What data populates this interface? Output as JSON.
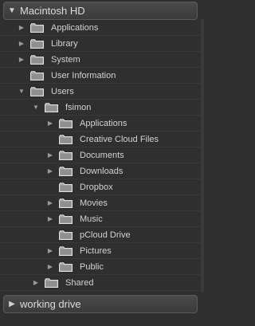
{
  "volume_header": {
    "arrow": "▼",
    "title": "Macintosh HD",
    "expanded": true
  },
  "tree": [
    {
      "label": "Applications",
      "depth": 0,
      "expander": "collapsed"
    },
    {
      "label": "Library",
      "depth": 0,
      "expander": "collapsed"
    },
    {
      "label": "System",
      "depth": 0,
      "expander": "collapsed"
    },
    {
      "label": "User Information",
      "depth": 0,
      "expander": "none"
    },
    {
      "label": "Users",
      "depth": 0,
      "expander": "expanded"
    },
    {
      "label": "fsimon",
      "depth": 1,
      "expander": "expanded"
    },
    {
      "label": "Applications",
      "depth": 2,
      "expander": "collapsed"
    },
    {
      "label": "Creative Cloud Files",
      "depth": 2,
      "expander": "none"
    },
    {
      "label": "Documents",
      "depth": 2,
      "expander": "collapsed"
    },
    {
      "label": "Downloads",
      "depth": 2,
      "expander": "collapsed"
    },
    {
      "label": "Dropbox",
      "depth": 2,
      "expander": "none"
    },
    {
      "label": "Movies",
      "depth": 2,
      "expander": "collapsed"
    },
    {
      "label": "Music",
      "depth": 2,
      "expander": "collapsed"
    },
    {
      "label": "pCloud Drive",
      "depth": 2,
      "expander": "none"
    },
    {
      "label": "Pictures",
      "depth": 2,
      "expander": "collapsed"
    },
    {
      "label": "Public",
      "depth": 2,
      "expander": "collapsed"
    },
    {
      "label": "Shared",
      "depth": 1,
      "expander": "collapsed"
    }
  ],
  "footer_header": {
    "arrow": "▶",
    "title": "working drive",
    "expanded": false
  },
  "icons": {
    "folder": "folder-icon",
    "expanded": "triangle-down-icon",
    "collapsed": "triangle-right-icon"
  },
  "colors": {
    "background": "#2f2f2f",
    "text": "#d2d2d2",
    "header_bg": "#404040",
    "folder": "#b8b8b8"
  }
}
